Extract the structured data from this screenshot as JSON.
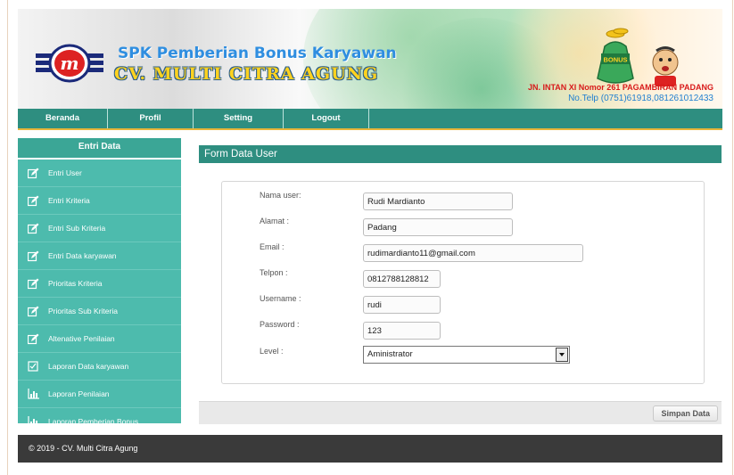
{
  "header": {
    "title_line1": "SPK Pemberian Bonus Karyawan",
    "title_line2": "CV. MULTI CITRA AGUNG",
    "address": "JN. INTAN XI Nomor 261 PAGAMBIRAN PADANG",
    "phone": "No.Telp (0751)61918,081261012433",
    "bag_label": "BONUS",
    "logo_letter": "m"
  },
  "nav": {
    "items": [
      "Beranda",
      "Profil",
      "Setting",
      "Logout"
    ]
  },
  "sidebar": {
    "title": "Entri Data",
    "items": [
      {
        "label": "Entri User",
        "icon": "edit-icon"
      },
      {
        "label": "Entri Kriteria",
        "icon": "edit-icon"
      },
      {
        "label": "Entri Sub Kriteria",
        "icon": "edit-icon"
      },
      {
        "label": "Entri Data karyawan",
        "icon": "edit-icon"
      },
      {
        "label": "Prioritas Kriteria",
        "icon": "edit-icon"
      },
      {
        "label": "Prioritas Sub Kriteria",
        "icon": "edit-icon"
      },
      {
        "label": "Altenative Penilaian",
        "icon": "edit-icon"
      },
      {
        "label": "Laporan Data karyawan",
        "icon": "document-icon"
      },
      {
        "label": "Laporan Penilaian",
        "icon": "chart-icon"
      },
      {
        "label": "Laporan Pemberian Bonus",
        "icon": "chart-icon"
      }
    ]
  },
  "form": {
    "title": "Form Data User",
    "fields": {
      "nama": {
        "label": "Nama user:",
        "value": "Rudi Mardianto"
      },
      "alamat": {
        "label": "Alamat :",
        "value": "Padang"
      },
      "email": {
        "label": "Email :",
        "value": "rudimardianto11@gmail.com"
      },
      "telpon": {
        "label": "Telpon :",
        "value": "0812788128812"
      },
      "username": {
        "label": "Username :",
        "value": "rudi"
      },
      "password": {
        "label": "Password :",
        "value": "123"
      },
      "level": {
        "label": "Level :",
        "value": "Aministrator"
      }
    },
    "submit_label": "Simpan Data"
  },
  "footer": {
    "text": "© 2019 - CV. Multi Citra Agung"
  },
  "colors": {
    "teal": "#2e8e80",
    "sidebar": "#4dbbad",
    "gold": "#ffd21f",
    "blue": "#2f8ee0",
    "red": "#d81a1a"
  }
}
